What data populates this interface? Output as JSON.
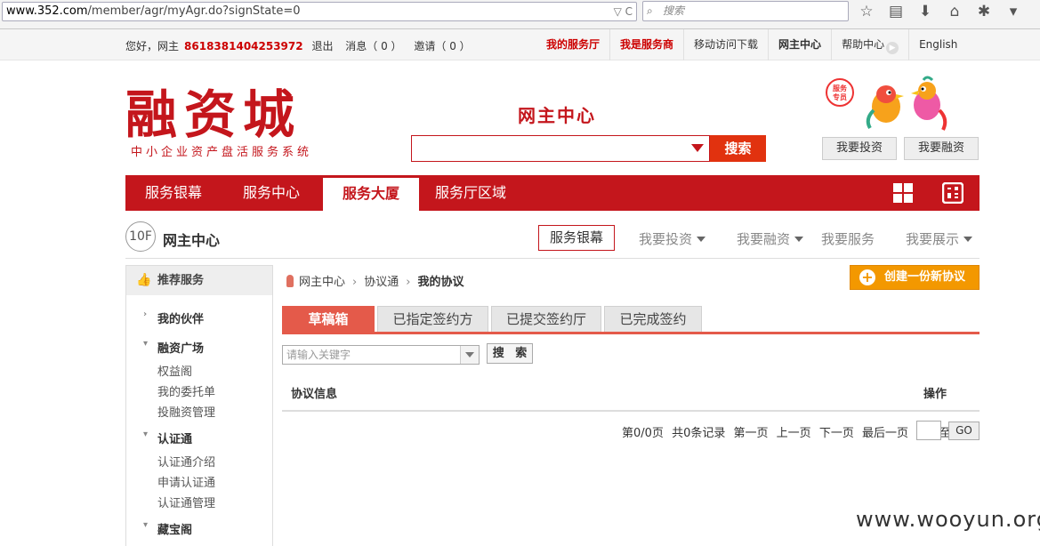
{
  "browser": {
    "url_host": "www.352.com",
    "url_path": "/member/agr/myAgr.do?signState=0",
    "url_controls": "▽ C",
    "search_placeholder": "搜索"
  },
  "topbar": {
    "greeting": "您好，网主",
    "user_id": "8618381404253972",
    "logout": "退出",
    "messages": "消息（ 0 ）",
    "invites": "邀请（ 0 ）",
    "nav": [
      "我的服务厅",
      "我是服务商",
      "移动访问下载",
      "网主中心",
      "帮助中心",
      "English"
    ]
  },
  "header": {
    "logo_text": "融资城",
    "logo_sub": "中小企业资产盘活服务系统",
    "center_title": "网主中心",
    "search_button": "搜索",
    "mascot_badge": "服务专员",
    "btn_invest": "我要投资",
    "btn_finance": "我要融资"
  },
  "mainnav": {
    "items": [
      "服务银幕",
      "服务中心",
      "服务大厦",
      "服务厅区域"
    ]
  },
  "floor": {
    "badge": "10F",
    "title": "网主中心",
    "subnav_active": "服务银幕",
    "subnav": [
      "我要投资",
      "我要融资",
      "我要服务",
      "我要展示"
    ]
  },
  "sidebar": {
    "head": "推荐服务",
    "sections": [
      {
        "title": "我的伙伴",
        "links": []
      },
      {
        "title": "融资广场",
        "links": [
          "权益阁",
          "我的委托单",
          "投融资管理"
        ]
      },
      {
        "title": "认证通",
        "links": [
          "认证通介绍",
          "申请认证通",
          "认证通管理"
        ]
      },
      {
        "title": "藏宝阁",
        "links": []
      }
    ]
  },
  "breadcrumb": [
    "网主中心",
    "协议通",
    "我的协议"
  ],
  "create_button": "创建一份新协议",
  "tabs": [
    "草稿箱",
    "已指定签约方",
    "已提交签约厅",
    "已完成签约"
  ],
  "filter": {
    "placeholder": "请输入关键字",
    "button": "搜 索"
  },
  "table": {
    "col_info": "协议信息",
    "col_action": "操作"
  },
  "pager": {
    "page": "第0/0页",
    "total": "共0条记录",
    "first": "第一页",
    "prev": "上一页",
    "next": "下一页",
    "last": "最后一页",
    "jump": "跳转至",
    "go": "GO"
  },
  "watermark": "www.wooyun.org"
}
